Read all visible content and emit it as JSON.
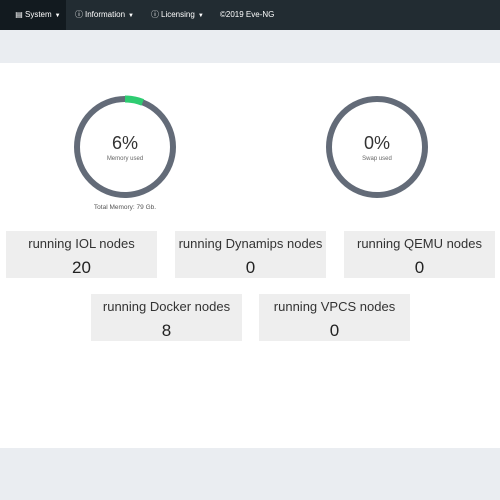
{
  "navbar": {
    "items": [
      {
        "label": "System",
        "icon": "book-icon"
      },
      {
        "label": "Information",
        "icon": "info-circle-icon"
      },
      {
        "label": "Licensing",
        "icon": "info-circle-icon"
      }
    ],
    "copyright": "©2019 Eve-NG"
  },
  "gauges": {
    "memory": {
      "value": "6%",
      "label": "Memory used",
      "percent": 6,
      "track_color": "#636b78",
      "fill_color": "#2ecc71"
    },
    "swap": {
      "value": "0%",
      "label": "Swap used",
      "percent": 0,
      "track_color": "#636b78",
      "fill_color": "#2ecc71"
    },
    "total_memory": "Total Memory: 79 Gb."
  },
  "nodes": [
    {
      "title": "running IOL nodes",
      "count": "20"
    },
    {
      "title": "running Dynamips nodes",
      "count": "0"
    },
    {
      "title": "running QEMU nodes",
      "count": "0"
    },
    {
      "title": "running Docker nodes",
      "count": "8"
    },
    {
      "title": "running VPCS nodes",
      "count": "0"
    }
  ]
}
